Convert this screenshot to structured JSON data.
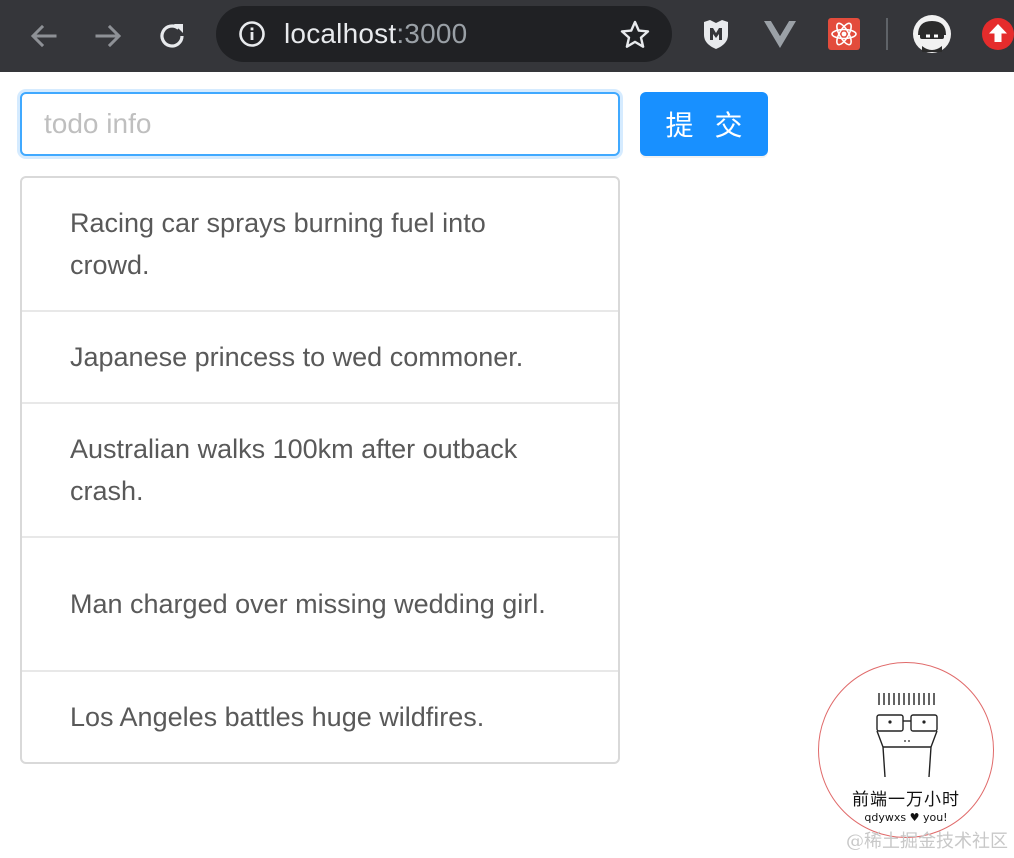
{
  "browser": {
    "url_host": "localhost",
    "url_port": ":3000",
    "icons": {
      "back": "arrow-left-icon",
      "forward": "arrow-right-icon",
      "reload": "reload-icon",
      "info": "info-icon",
      "bookmark": "star-icon",
      "extensions": [
        "shield-extension-icon",
        "vue-devtools-icon",
        "react-devtools-icon"
      ],
      "profile": "avatar",
      "update": "update-arrow-icon"
    }
  },
  "form": {
    "placeholder": "todo info",
    "value": "",
    "submit_label": "提 交"
  },
  "todos": [
    "Racing car sprays burning fuel into crowd.",
    "Japanese princess to wed commoner.",
    "Australian walks 100km after outback crash.",
    "Man charged over missing wedding girl.",
    "Los Angeles battles huge wildfires."
  ],
  "watermark": {
    "badge_title": "前端一万小时",
    "badge_sub": "qdywxs ♥ you!",
    "site": "@稀土掘金技术社区"
  },
  "colors": {
    "toolbar_bg": "#35363a",
    "omnibox_bg": "#202124",
    "primary": "#1890ff",
    "input_focus": "#40a9ff",
    "border": "#d9d9d9",
    "text": "#595959"
  }
}
